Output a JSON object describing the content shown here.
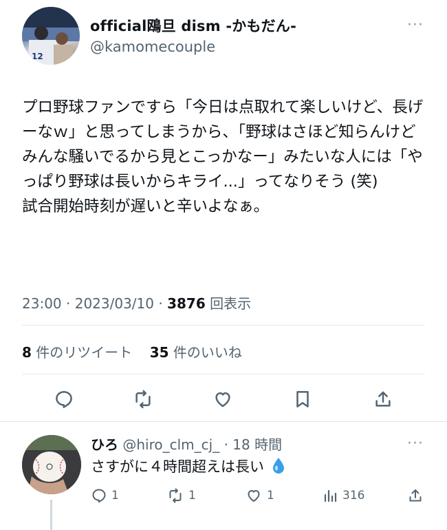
{
  "tweet": {
    "author_name": "official鴎旦 dism -かもだん-",
    "author_handle": "@kamomecouple",
    "body": "プロ野球ファンですら「今日は点取れて楽しいけど、長げーなｗ」と思ってしまうから、「野球はさほど知らんけどみんな騒いでるから見とこっかなー」みたいな人には「やっぱり野球は長いからキライ...」ってなりそう (笑)\n試合開始時刻が遅いと辛いよなぁ。",
    "time": "23:00",
    "date": "2023/03/10",
    "view_count": "3876",
    "view_label": "回表示",
    "retweet_count": "8",
    "retweet_label": "件のリツイート",
    "like_count": "35",
    "like_label": "件のいいね",
    "more_label": "···",
    "icons": [
      "reply-icon",
      "retweet-icon",
      "like-icon",
      "bookmark-icon",
      "share-icon"
    ]
  },
  "reply": {
    "author_name": "ひろ",
    "author_handle": "@hiro_clm_cj_",
    "time_ago": "18 時間",
    "text": "さすがに４時間超えは長い",
    "reply_count": "1",
    "retweet_count": "1",
    "like_count": "1",
    "view_count": "316",
    "more_label": "···",
    "icons": [
      "reply-icon",
      "retweet-icon",
      "like-icon",
      "views-icon",
      "share-icon",
      "droplet-emoji-icon"
    ]
  },
  "colors": {
    "text": "#0f1419",
    "muted": "#536471",
    "divider": "#e6e9ec",
    "droplet": "#3a9ee8"
  }
}
